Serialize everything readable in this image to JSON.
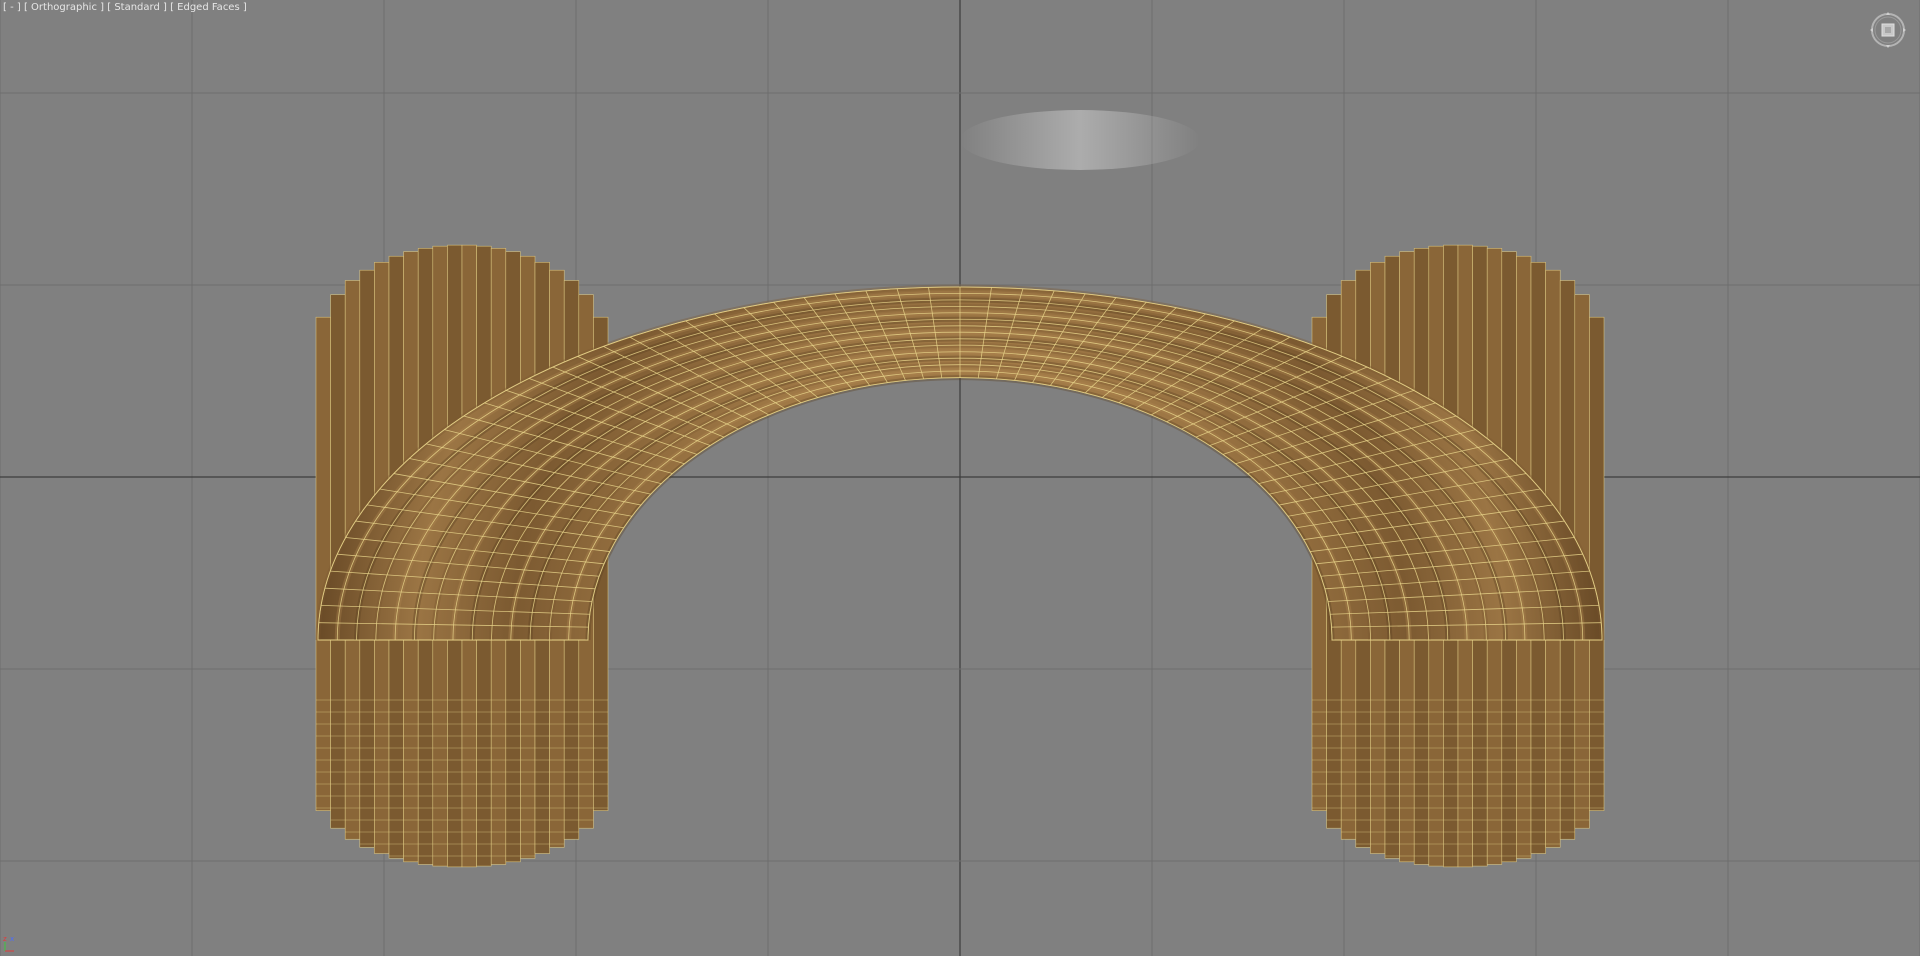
{
  "viewport": {
    "label_minus": "[ - ]",
    "label_view": "[ Orthographic ]",
    "label_shading": "[ Standard ]",
    "label_mode": "[ Edged Faces ]"
  },
  "colors": {
    "background": "#808080",
    "grid_line": "#6e6e6e",
    "grid_axis": "#3c3c3c",
    "wood_mid": "#8a6537",
    "wood_dark": "#5a4020",
    "wood_light": "#b08750",
    "wire_edge": "#e8d48a"
  },
  "icons": {
    "viewcube": "viewcube-icon",
    "axis_tripod": "axis-tripod-icon"
  },
  "axis_tripod": {
    "z_label": "z",
    "x_label": "x",
    "y_label": "y"
  }
}
